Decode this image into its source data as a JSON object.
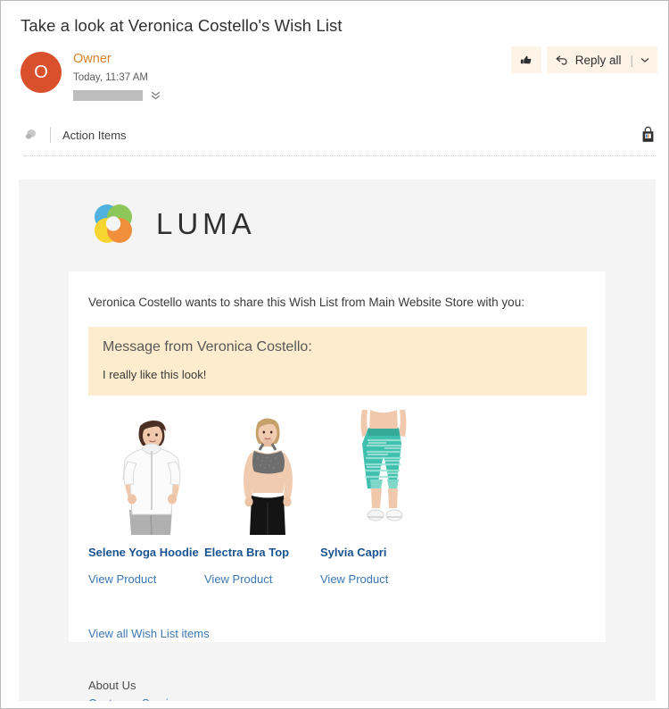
{
  "message": {
    "subject": "Take a look at Veronica Costello's Wish List",
    "sender_name": "Owner",
    "sender_initial": "O",
    "timestamp": "Today, 11:37 AM"
  },
  "toolbar": {
    "like_icon": "thumbs-up-icon",
    "reply_all_label": "Reply all",
    "reply_icon": "reply-all-icon",
    "separator": "|",
    "caret": "⌄",
    "expand_recipients_icon": "double-chevron-down-icon"
  },
  "action_items": {
    "icon": "chat-bubble-icon",
    "label": "Action Items",
    "right_icon": "shopping-bag-icon"
  },
  "email": {
    "brand": "LUMA",
    "brand_logo_icon": "luma-flower-logo",
    "share_line": "Veronica Costello wants to share this Wish List from Main Website Store with you:",
    "message_box": {
      "title": "Message from Veronica Costello:",
      "body": "I really like this look!"
    },
    "products": [
      {
        "name": "Selene Yoga Hoodie",
        "link_label": "View Product",
        "image": "woman-white-hoodie-gray-pants"
      },
      {
        "name": "Electra Bra Top",
        "link_label": "View Product",
        "image": "woman-gray-sports-bra-black-pants"
      },
      {
        "name": "Sylvia Capri",
        "link_label": "View Product",
        "image": "teal-striped-capri-leggings"
      }
    ],
    "view_all_label": "View all Wish List items",
    "footer": {
      "about_label": "About Us",
      "customer_service_label": "Customer Service"
    }
  },
  "colors": {
    "avatar_orange": "#d9512c",
    "sender_name_orange": "#d9822b",
    "action_button_bg": "#fdf3e7",
    "message_box_bg": "#fdeccd",
    "email_body_bg": "#f4f4f4",
    "product_name_blue": "#1a5490",
    "link_blue": "#3b78b5"
  }
}
